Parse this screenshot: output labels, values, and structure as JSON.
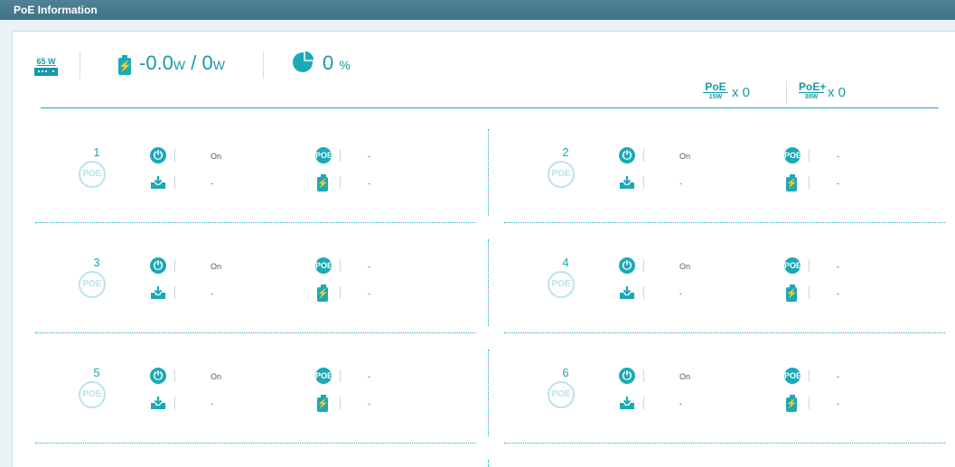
{
  "window": {
    "title": "PoE Information"
  },
  "summary": {
    "psu_label": "65 W",
    "power_value": "-0.0",
    "power_unit_1": "W",
    "power_sep": " / ",
    "power_max": "0",
    "power_unit_2": "W",
    "utilization_value": "0",
    "utilization_unit": "%",
    "poe_type": {
      "num": "PoE",
      "den": "15W",
      "count": "x 0"
    },
    "poe_plus_type": {
      "num": "PoE+",
      "den": "30W",
      "count": "x 0"
    }
  },
  "ports": [
    {
      "number": "1",
      "status": "On",
      "poe_class": "-",
      "port_load": "-",
      "port_power": "-"
    },
    {
      "number": "2",
      "status": "On",
      "poe_class": "-",
      "port_load": "-",
      "port_power": "-"
    },
    {
      "number": "3",
      "status": "On",
      "poe_class": "-",
      "port_load": "-",
      "port_power": "-"
    },
    {
      "number": "4",
      "status": "On",
      "poe_class": "-",
      "port_load": "-",
      "port_power": "-"
    },
    {
      "number": "5",
      "status": "On",
      "poe_class": "-",
      "port_load": "-",
      "port_power": "-"
    },
    {
      "number": "6",
      "status": "On",
      "poe_class": "-",
      "port_load": "-",
      "port_power": "-"
    }
  ],
  "icon_text": {
    "poe": "POE",
    "poe_circle": "POE"
  },
  "colors": {
    "accent": "#1ba9b6",
    "titlebar": "#467a8c",
    "ring": "#b9e4ea"
  }
}
